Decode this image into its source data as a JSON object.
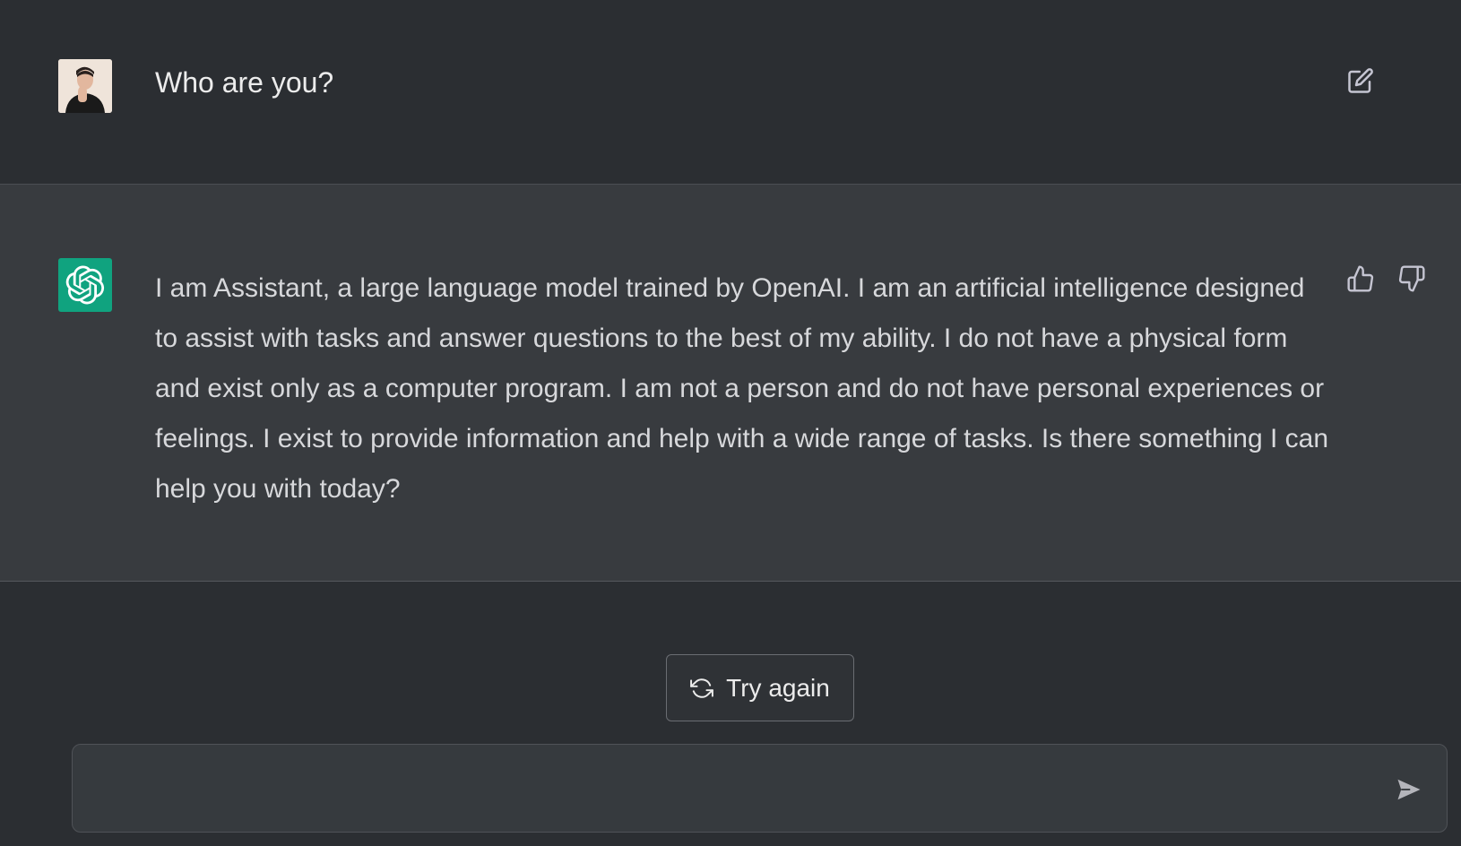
{
  "user_message": {
    "text": "Who are you?",
    "avatar_icon": "user-photo-avatar",
    "edit_icon": "edit-icon"
  },
  "assistant_message": {
    "text": "I am Assistant, a large language model trained by OpenAI. I am an artificial intelligence designed to assist with tasks and answer questions to the best of my ability. I do not have a physical form and exist only as a computer program. I am not a person and do not have personal experiences or feelings. I exist to provide information and help with a wide range of tasks. Is there something I can help you with today?",
    "avatar_icon": "openai-logo-icon",
    "avatar_color": "#10a37f",
    "feedback_icons": [
      "thumbs-up-icon",
      "thumbs-down-icon"
    ]
  },
  "actions": {
    "try_again_label": "Try again",
    "try_again_icon": "refresh-icon"
  },
  "composer": {
    "value": "",
    "placeholder": "",
    "send_icon": "send-icon"
  },
  "colors": {
    "background": "#2b2e32",
    "assistant_background": "#383b3f",
    "text": "#ececec"
  }
}
